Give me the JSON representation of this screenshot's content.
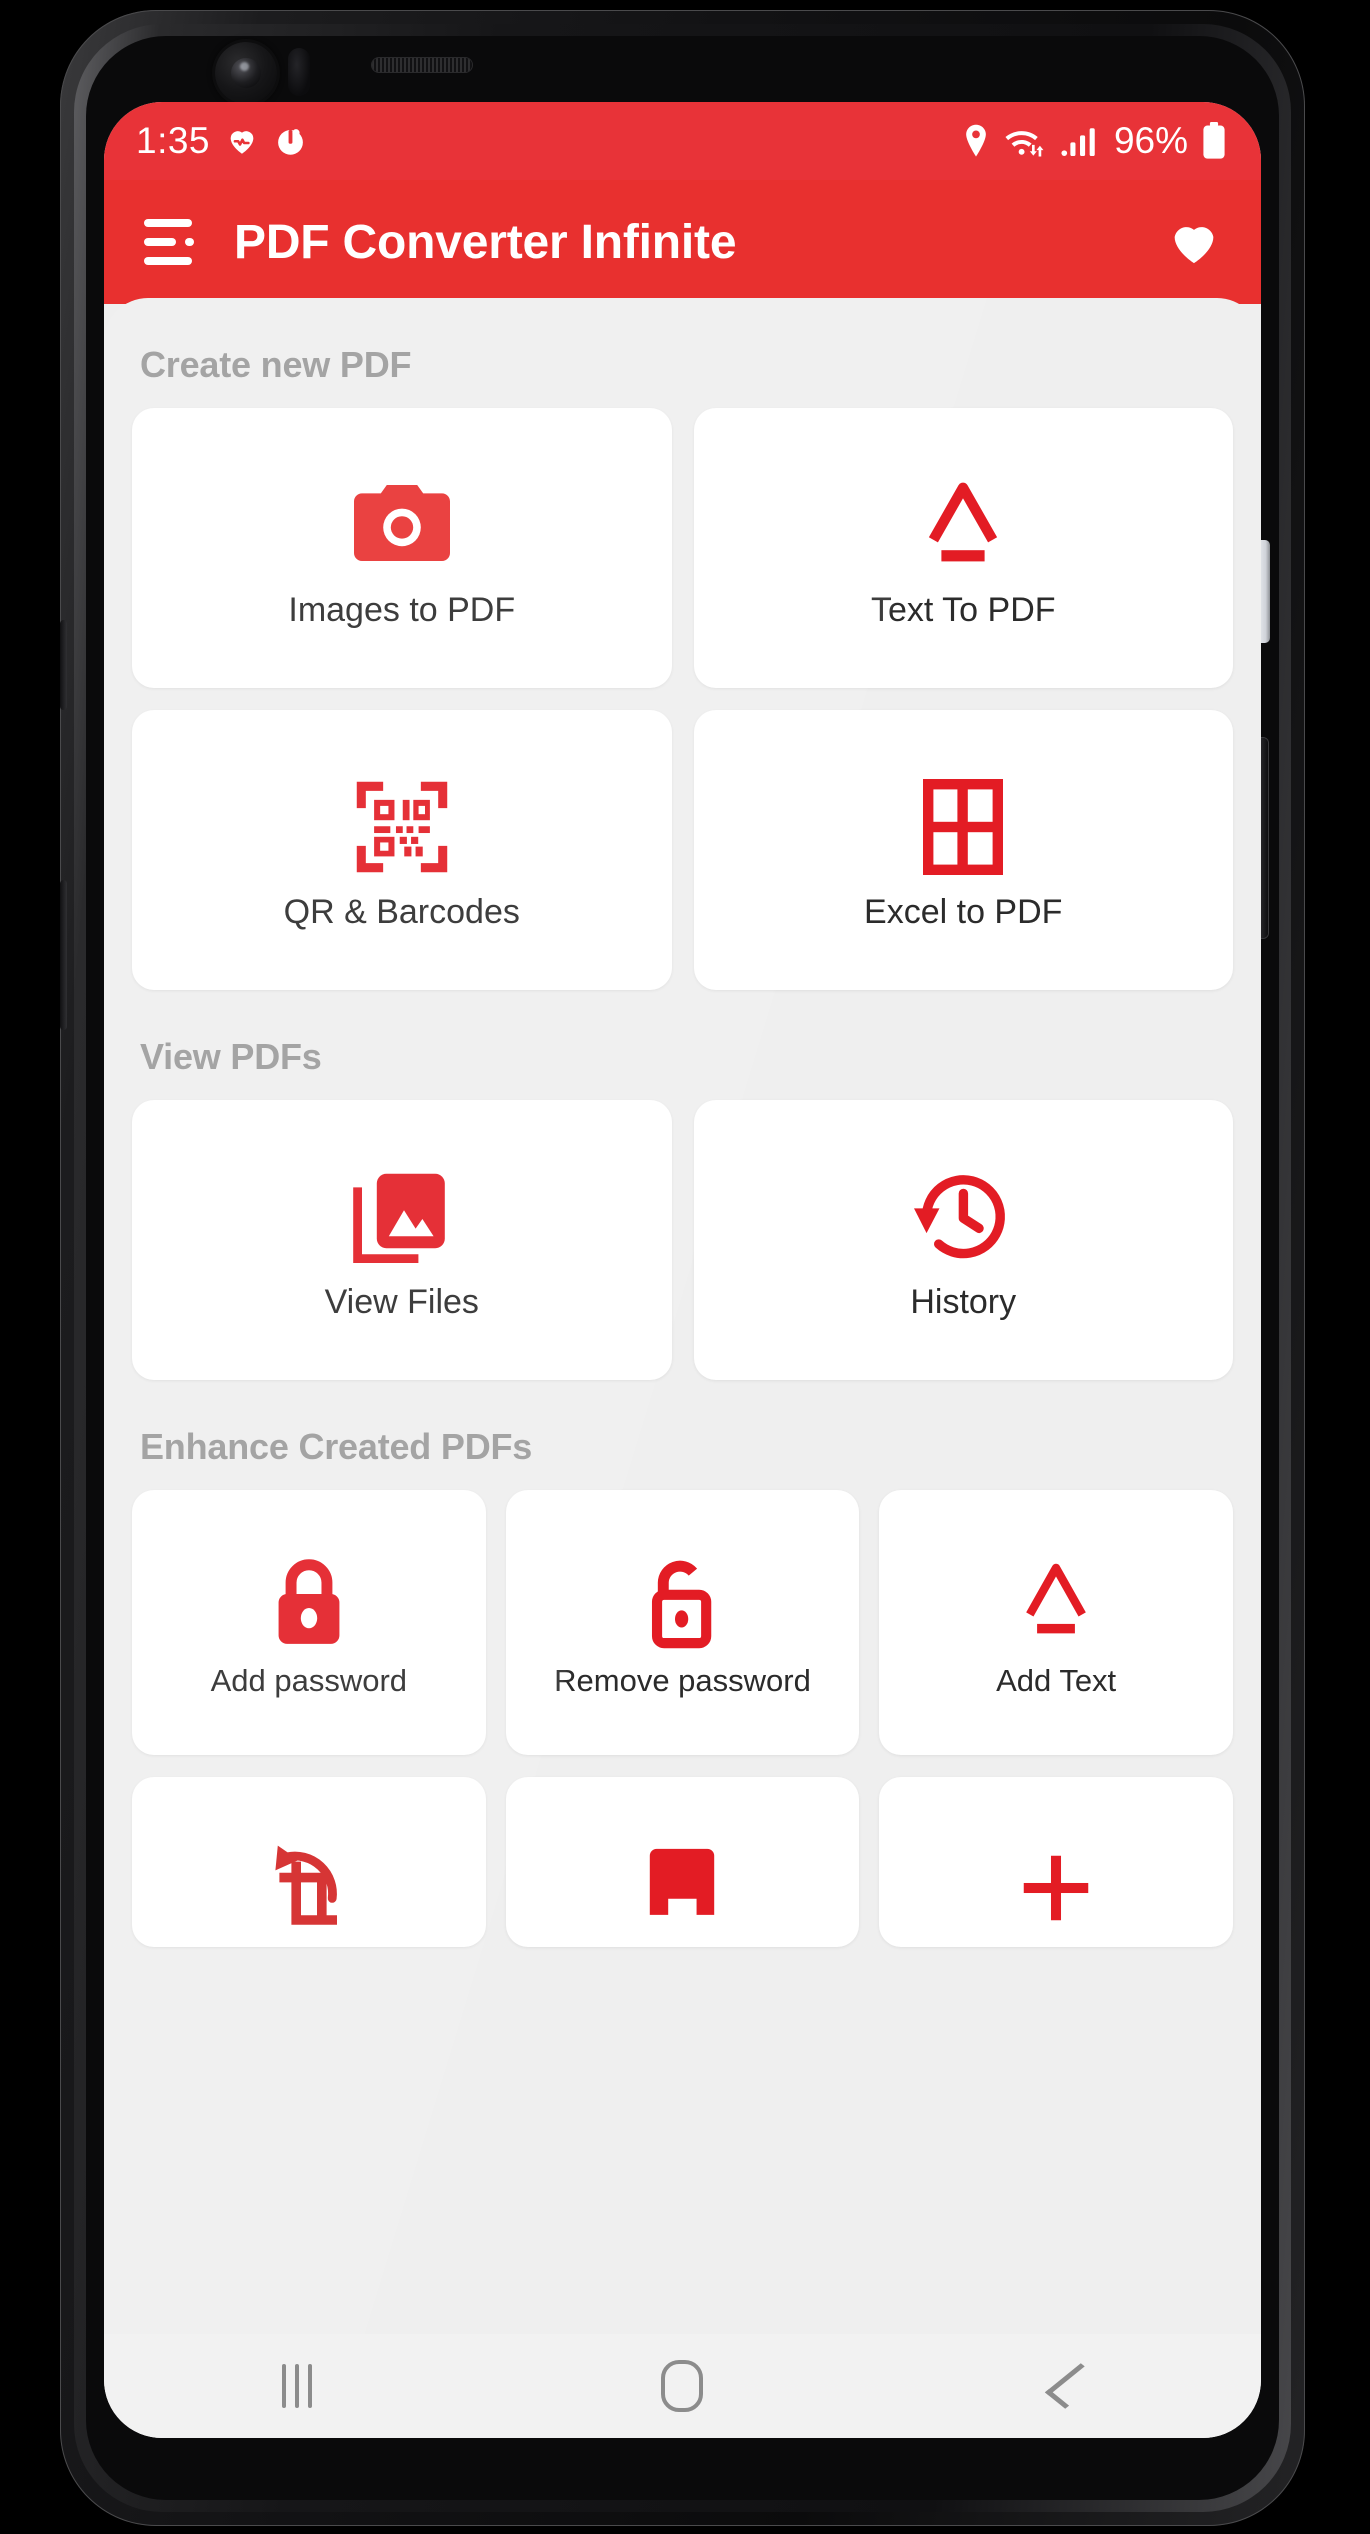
{
  "statusbar": {
    "time": "1:35",
    "battery_percent": "96%",
    "icons": [
      "heart-rate-icon",
      "timer-icon",
      "location-pin-icon",
      "wifi-icon",
      "cellular-signal-icon",
      "battery-icon"
    ]
  },
  "appbar": {
    "menu_icon": "hamburger-menu-icon",
    "title": "PDF Converter Infinite",
    "favorite_icon": "heart-icon"
  },
  "colors": {
    "brand_red": "#e8302f",
    "status_red": "#e83338",
    "icon_red": "#e31c24",
    "page_bg": "#efefef",
    "card_bg": "#ffffff",
    "section_label": "#9b9b9b",
    "card_label": "#2b2b2b"
  },
  "sections": [
    {
      "title": "Create new PDF",
      "columns": 2,
      "cards": [
        {
          "label": "Images to PDF",
          "icon": "camera-icon"
        },
        {
          "label": "Text To PDF",
          "icon": "text-underline-a-icon"
        },
        {
          "label": "QR & Barcodes",
          "icon": "qr-barcode-scan-icon"
        },
        {
          "label": "Excel to PDF",
          "icon": "excel-grid-icon"
        }
      ]
    },
    {
      "title": "View PDFs",
      "columns": 2,
      "cards": [
        {
          "label": "View Files",
          "icon": "photo-library-icon"
        },
        {
          "label": "History",
          "icon": "history-clock-icon"
        }
      ]
    },
    {
      "title": "Enhance Created PDFs",
      "columns": 3,
      "cards": [
        {
          "label": "Add password",
          "icon": "lock-closed-icon"
        },
        {
          "label": "Remove password",
          "icon": "lock-open-icon"
        },
        {
          "label": "Add Text",
          "icon": "text-underline-a-icon"
        }
      ]
    }
  ],
  "partial_row": {
    "cards": [
      {
        "icon": "rotate-crop-icon"
      },
      {
        "icon": "page-shape-icon"
      },
      {
        "icon": "plus-icon"
      }
    ]
  },
  "navbar": {
    "recents_label": "recents-icon",
    "home_label": "home-icon",
    "back_label": "back-icon"
  }
}
